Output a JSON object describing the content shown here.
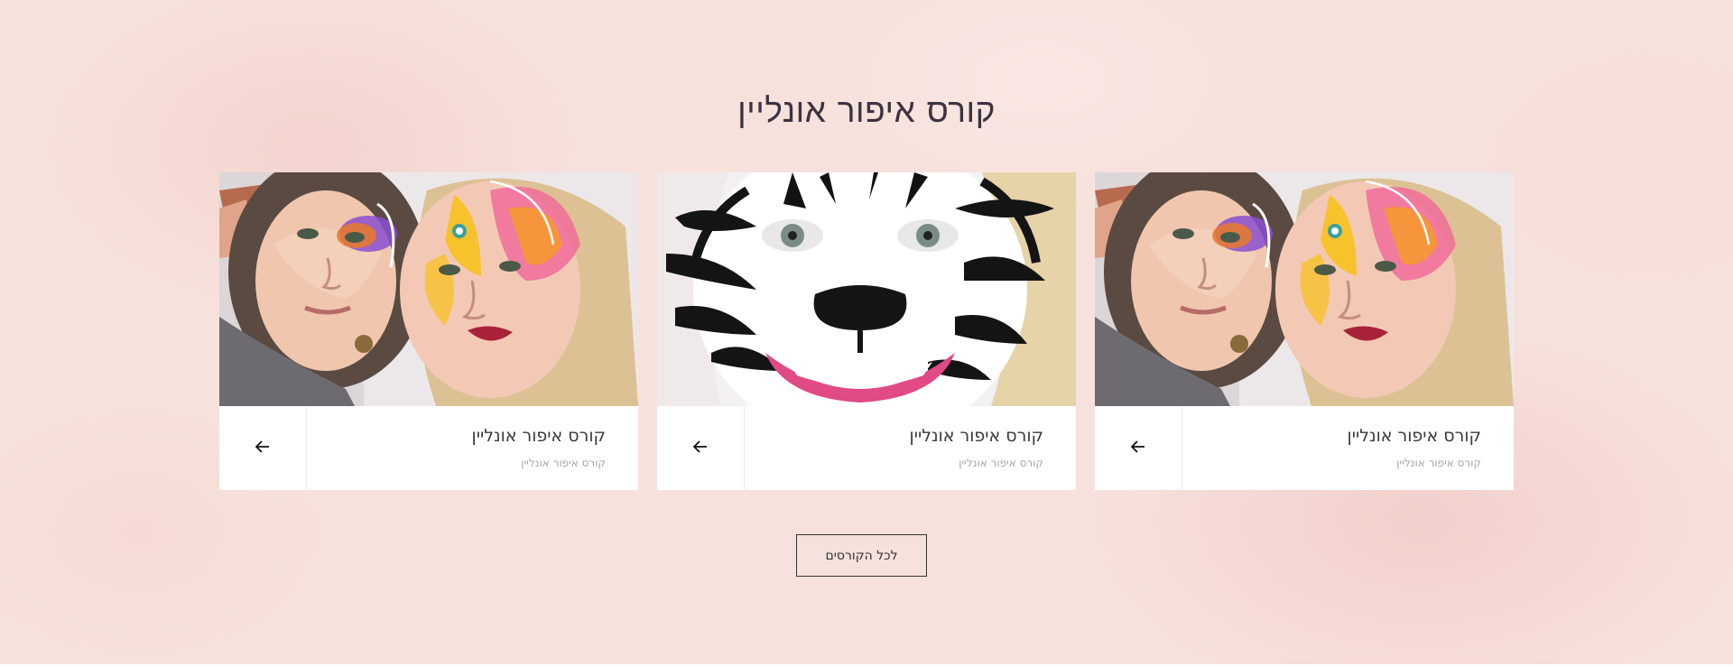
{
  "section": {
    "title": "קורס איפור אונליין"
  },
  "cards": [
    {
      "title": "קורס איפור אונליין",
      "subtitle": "קורס איפור אונליין",
      "image": "butterfly-face-paint-photo",
      "arrow_icon": "arrow-left-icon"
    },
    {
      "title": "קורס איפור אונליין",
      "subtitle": "קורס איפור אונליין",
      "image": "zebra-face-paint-photo",
      "arrow_icon": "arrow-left-icon"
    },
    {
      "title": "קורס איפור אונליין",
      "subtitle": "קורס איפור אונליין",
      "image": "butterfly-face-paint-photo",
      "arrow_icon": "arrow-left-icon"
    }
  ],
  "all_courses_button": {
    "label": "לכל הקורסים"
  },
  "colors": {
    "background": "#f7e1dc",
    "card_background": "#ffffff",
    "title_text": "#3b3340",
    "subtitle_text": "#a4a4a4",
    "button_border": "#333333"
  }
}
